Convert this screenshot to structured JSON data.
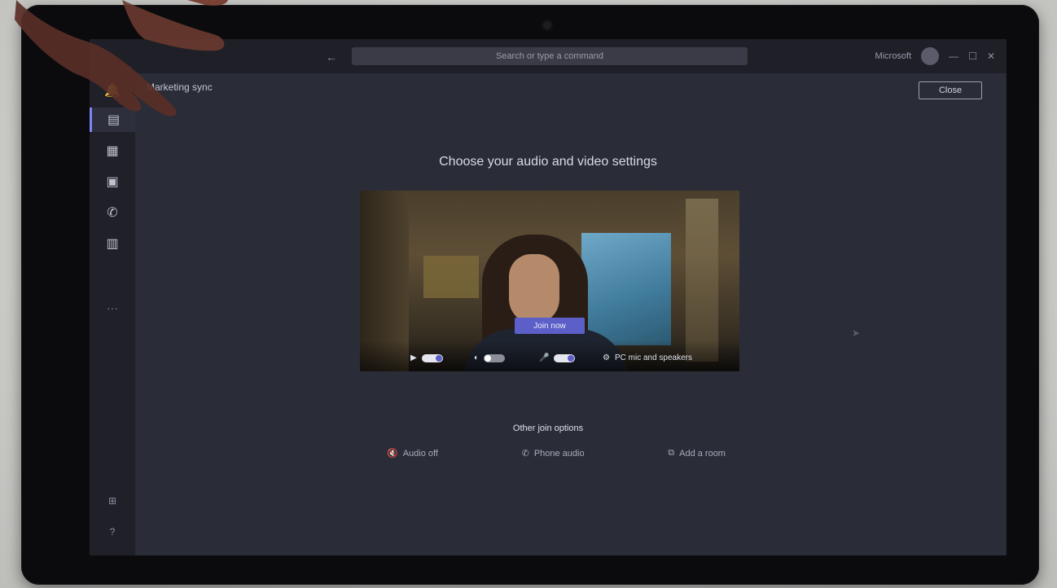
{
  "titlebar": {
    "back": "←",
    "search_placeholder": "Search or type a command",
    "user_label": "Microsoft",
    "window_controls": [
      "—",
      "☐",
      "✕"
    ]
  },
  "rail": {
    "items": [
      {
        "icon": "bell-icon",
        "glyph": "🔔",
        "active": false
      },
      {
        "icon": "chat-icon",
        "glyph": "▤",
        "active": true
      },
      {
        "icon": "teams-icon",
        "glyph": "▦",
        "active": false
      },
      {
        "icon": "calendar-icon",
        "glyph": "▣",
        "active": false
      },
      {
        "icon": "calls-icon",
        "glyph": "✆",
        "active": false
      },
      {
        "icon": "files-icon",
        "glyph": "▥",
        "active": false
      }
    ],
    "more": "···",
    "apps_glyph": "⊞",
    "help_glyph": "?"
  },
  "meeting": {
    "title": "Marketing sync",
    "close_label": "Close",
    "heading": "Choose your audio and video settings",
    "join_label": "Join now"
  },
  "controls": {
    "video": {
      "glyph": "▶",
      "on": true
    },
    "blur": {
      "glyph": "◐",
      "on": false
    },
    "mic": {
      "glyph": "🎤",
      "on": true
    },
    "device": {
      "glyph": "⚙",
      "label": "PC mic and speakers"
    }
  },
  "other_options": {
    "label": "Other join options",
    "items": [
      {
        "glyph": "🔇",
        "label": "Audio off"
      },
      {
        "glyph": "✆",
        "label": "Phone audio"
      },
      {
        "glyph": "⧉",
        "label": "Add a room"
      }
    ]
  },
  "colors": {
    "accent": "#5b5fc7",
    "background": "#2a2c37",
    "rail": "#202028"
  }
}
